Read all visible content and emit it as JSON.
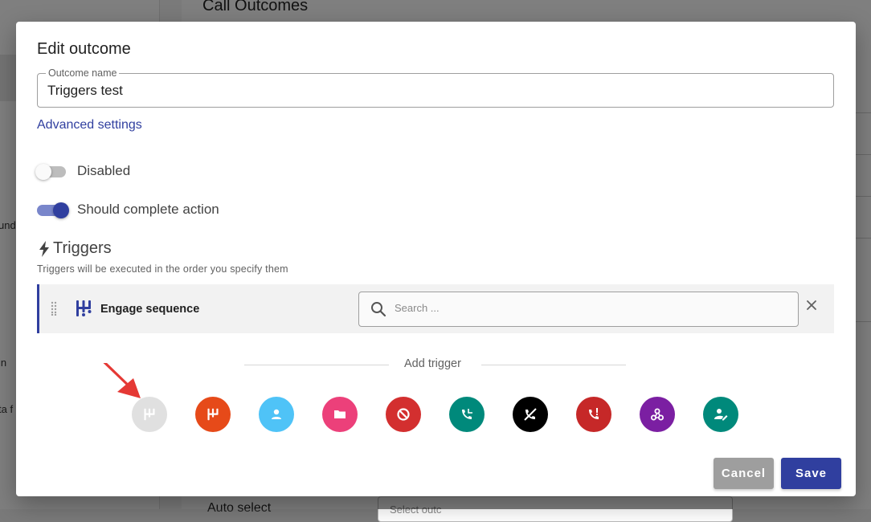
{
  "background": {
    "page_title": "Call Outcomes",
    "sidebar_fragments": [
      "und",
      "in",
      "ta f"
    ],
    "bottom_label": "Auto select",
    "bottom_input_placeholder": "Select outc"
  },
  "dialog": {
    "title": "Edit outcome",
    "outcome_name_label": "Outcome name",
    "outcome_name_value": "Triggers test",
    "advanced_settings_link": "Advanced settings",
    "toggles": [
      {
        "label": "Disabled",
        "on": false
      },
      {
        "label": "Should complete action",
        "on": true
      }
    ],
    "triggers": {
      "heading": "Triggers",
      "description": "Triggers will be executed in the order you specify them",
      "items": [
        {
          "name": "Engage sequence",
          "icon": "sequence-icon",
          "search_placeholder": "Search ..."
        }
      ]
    },
    "add_trigger": {
      "label": "Add trigger",
      "buttons": [
        {
          "name": "engage-sequence",
          "icon": "sequence-icon",
          "color": "#e0e0e0"
        },
        {
          "name": "unenroll-sequence",
          "icon": "sequence-icon",
          "color": "#e64a19"
        },
        {
          "name": "assign-user",
          "icon": "person-icon",
          "color": "#4fc3f7"
        },
        {
          "name": "move-to-folder",
          "icon": "folder-icon",
          "color": "#ec407a"
        },
        {
          "name": "block",
          "icon": "block-icon",
          "color": "#d32f2f"
        },
        {
          "name": "callback",
          "icon": "phone-callback-icon",
          "color": "#00897b"
        },
        {
          "name": "do-not-call",
          "icon": "phone-disabled-icon",
          "color": "#000000"
        },
        {
          "name": "call-alert",
          "icon": "phone-alert-icon",
          "color": "#c62828"
        },
        {
          "name": "webhook",
          "icon": "webhook-icon",
          "color": "#7b1fa2"
        },
        {
          "name": "update-contact",
          "icon": "person-edit-icon",
          "color": "#00897b"
        }
      ]
    },
    "actions": {
      "cancel": "Cancel",
      "save": "Save"
    }
  }
}
